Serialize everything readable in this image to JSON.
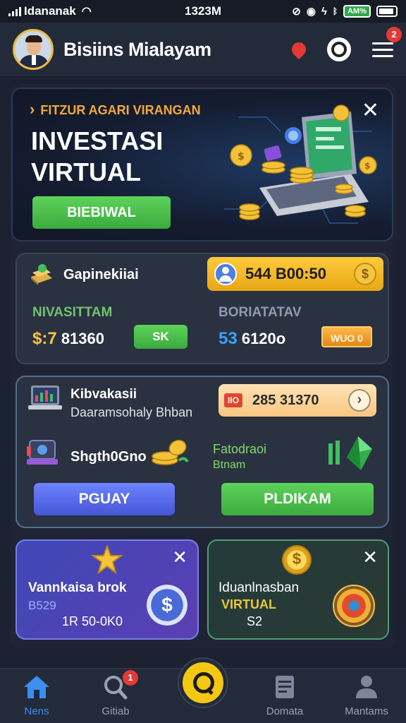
{
  "status_bar": {
    "carrier": "Idananak",
    "time": "1323M",
    "battery_pct": "AM%"
  },
  "header": {
    "title": "Bisiins Mialayam",
    "menu_badge": "2"
  },
  "hero": {
    "tag": "FITZUR AGARI VIRANGAN",
    "title": "INVESTASI VIRTUAL",
    "button": "BIEBIWAL"
  },
  "balance": {
    "name": "Gapinekiiai",
    "pill_value": "544 B00:50",
    "left_label": "NIVASITTAM",
    "left_value_hi": "$:7",
    "left_value": "81360",
    "mid_button": "SK",
    "right_label": "BORIATATAV",
    "right_value_hi": "53",
    "right_value": "6120o",
    "chip": "WUO  0"
  },
  "actions": {
    "title": "Kibvakasii",
    "subtitle": "Daaramsohaly Bhban",
    "pill_tag": "IIO",
    "pill_value": "285 31370",
    "item_label": "Shgth0Gno",
    "right_label": "Fatodraoi",
    "right_sub": "Btnam",
    "button_left": "PGUAY",
    "button_right": "PLDIKAM"
  },
  "mini_left": {
    "title": "Vannkaisa brok",
    "sub": "B529",
    "value": "1R 50-0K0"
  },
  "mini_right": {
    "title": "Iduanlnasban",
    "sub": "VIRTUAL",
    "value": "S2"
  },
  "nav": {
    "items": [
      {
        "label": "Nens",
        "icon": "home-icon"
      },
      {
        "label": "Gitiab",
        "icon": "search-icon",
        "badge": "1"
      },
      {
        "label": "",
        "icon": "search-fab-icon"
      },
      {
        "label": "Domata",
        "icon": "document-icon"
      },
      {
        "label": "Mantams",
        "icon": "user-icon"
      }
    ]
  },
  "colors": {
    "accent_gold": "#f4c542",
    "accent_green": "#4cbf4b",
    "accent_blue": "#3a8ff0",
    "badge_red": "#e53935"
  }
}
